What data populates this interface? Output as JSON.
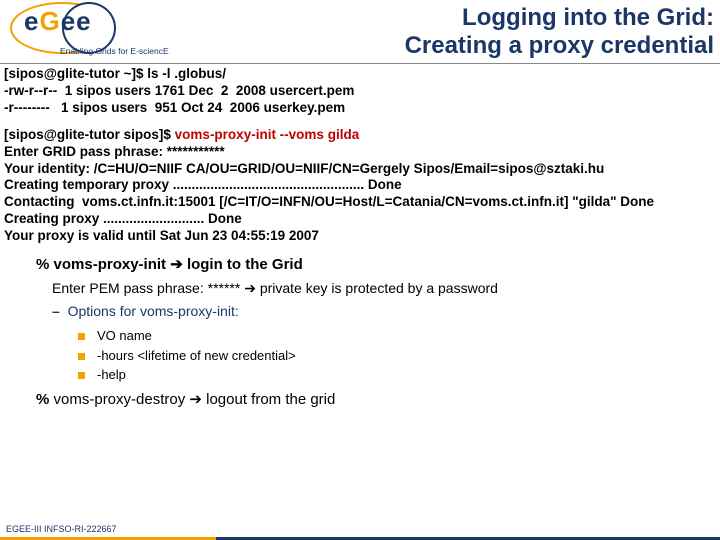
{
  "header": {
    "logo_main": "eGee",
    "tagline": "Enabling Grids for E-sciencE",
    "title_line1": "Logging into the Grid:",
    "title_line2": "Creating a proxy credential"
  },
  "terminal1": "[sipos@glite-tutor ~]$ ls -l .globus/\n-rw-r--r--  1 sipos users 1761 Dec  2  2008 usercert.pem\n-r--------   1 sipos users  951 Oct 24  2006 userkey.pem",
  "terminal2_pre": "[sipos@glite-tutor sipos]$ ",
  "terminal2_cmd": "voms-proxy-init --voms gilda",
  "terminal2_rest": "Enter GRID pass phrase: ***********\nYour identity: /C=HU/O=NIIF CA/OU=GRID/OU=NIIF/CN=Gergely Sipos/Email=sipos@sztaki.hu\nCreating temporary proxy ................................................... Done\nContacting  voms.ct.infn.it:15001 [/C=IT/O=INFN/OU=Host/L=Catania/CN=voms.ct.infn.it] \"gilda\" Done\nCreating proxy ........................... Done\nYour proxy is valid until Sat Jun 23 04:55:19 2007",
  "notes": {
    "cmd1_pre": "% ",
    "cmd1": "voms-proxy-init",
    "cmd1_arrow": "  ➔  ",
    "cmd1_post": "login to the Grid",
    "pem_line": "Enter PEM pass phrase: ****** ➔ private key is protected by a password",
    "opts_label": "Options for voms-proxy-init:",
    "opt1": "VO name",
    "opt2": "-hours <lifetime of new credential>",
    "opt3": "-help",
    "cmd2_pre": "% ",
    "cmd2": "voms-proxy-destroy ➔ logout from the grid"
  },
  "footer": "EGEE-III INFSO-RI-222667"
}
